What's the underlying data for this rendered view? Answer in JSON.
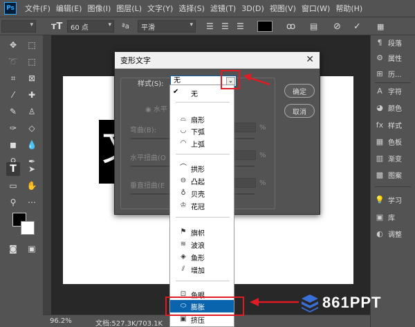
{
  "app": {
    "logo": "Ps"
  },
  "menubar": {
    "items": [
      "文件(F)",
      "编辑(E)",
      "图像(I)",
      "图层(L)",
      "文字(Y)",
      "选择(S)",
      "滤镜(T)",
      "3D(D)",
      "视图(V)",
      "窗口(W)",
      "帮助(H)"
    ]
  },
  "options": {
    "font_size": "60 点",
    "antialias_icon": "ªa",
    "antialias": "平滑"
  },
  "status": {
    "zoom": "96.2%",
    "doc": "文档:527.3K/703.1K"
  },
  "canvas": {
    "text_glyph": "文"
  },
  "panels": {
    "items": [
      {
        "icon": "paragraph-icon",
        "label": "段落"
      },
      {
        "icon": "properties-icon",
        "label": "属性"
      },
      {
        "icon": "history-icon",
        "label": "历..."
      },
      {
        "icon": "character-icon",
        "label": "字符"
      },
      {
        "icon": "color-icon",
        "label": "颜色"
      },
      {
        "icon": "styles-icon",
        "label": "样式"
      },
      {
        "icon": "swatches-icon",
        "label": "色板"
      },
      {
        "icon": "gradient-icon",
        "label": "渐变"
      },
      {
        "icon": "patterns-icon",
        "label": "图案"
      },
      {
        "icon": "learn-icon",
        "label": "学习"
      },
      {
        "icon": "library-icon",
        "label": "库"
      },
      {
        "icon": "adjustments-icon",
        "label": "调整"
      }
    ]
  },
  "dialog": {
    "title": "变形文字",
    "style_label": "样式(S):",
    "style_value": "无",
    "horizontal_radio": "水平",
    "bend_label": "弯曲(B):",
    "hdistort_label": "水平扭曲(O",
    "vdistort_label": "垂直扭曲(E",
    "percent": "%",
    "ok": "确定",
    "cancel": "取消"
  },
  "dropdown": {
    "checked": "无",
    "items": [
      {
        "icon": "arc-icon",
        "label": "扇形"
      },
      {
        "icon": "arc-lower-icon",
        "label": "下弧"
      },
      {
        "icon": "arc-upper-icon",
        "label": "上弧"
      },
      {
        "icon": "arch-icon",
        "label": "拱形"
      },
      {
        "icon": "bulge-icon",
        "label": "凸起"
      },
      {
        "icon": "shell-lower-icon",
        "label": "贝壳"
      },
      {
        "icon": "shell-upper-icon",
        "label": "花冠"
      },
      {
        "icon": "flag-icon",
        "label": "旗帜"
      },
      {
        "icon": "wave-icon",
        "label": "波浪"
      },
      {
        "icon": "fish-icon",
        "label": "鱼形"
      },
      {
        "icon": "rise-icon",
        "label": "增加"
      },
      {
        "icon": "fisheye-icon",
        "label": "鱼眼"
      },
      {
        "icon": "inflate-icon",
        "label": "膨胀"
      },
      {
        "icon": "squeeze-icon",
        "label": "挤压"
      }
    ]
  },
  "watermark": {
    "text": "861PPT"
  },
  "colors": {
    "highlight": "#e01b24",
    "selection": "#0a64ad",
    "watermark": "#3a6fd8"
  }
}
